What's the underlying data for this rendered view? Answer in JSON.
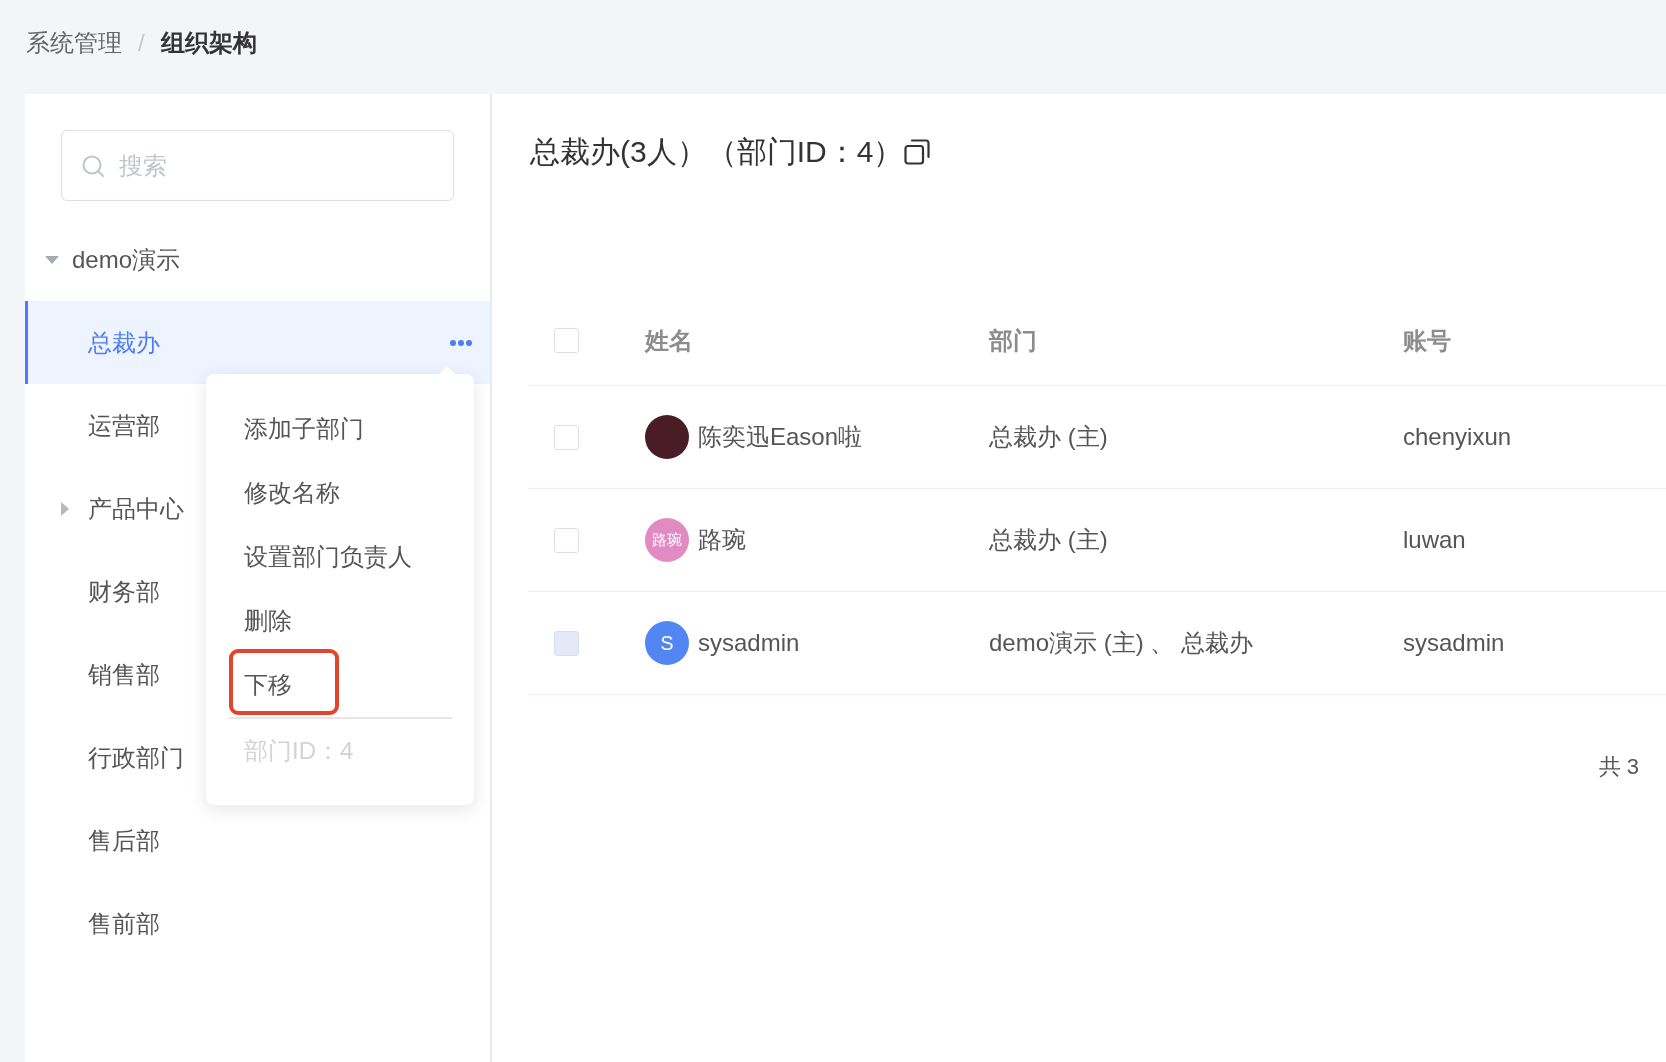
{
  "breadcrumb": {
    "items": [
      {
        "label": "系统管理",
        "current": false
      },
      {
        "label": "组织架构",
        "current": true
      }
    ],
    "separator": "/"
  },
  "sidebar": {
    "search": {
      "placeholder": "搜索"
    },
    "tree": [
      {
        "label": "demo演示",
        "kind": "folder",
        "expanded": true,
        "selected": false,
        "children": [
          {
            "label": "总裁办",
            "kind": "leaf",
            "selected": true
          },
          {
            "label": "运营部",
            "kind": "leaf",
            "selected": false
          },
          {
            "label": "产品中心",
            "kind": "folder",
            "expanded": false,
            "selected": false
          },
          {
            "label": "财务部",
            "kind": "leaf",
            "selected": false
          },
          {
            "label": "销售部",
            "kind": "leaf",
            "selected": false
          },
          {
            "label": "行政部门",
            "kind": "leaf",
            "selected": false
          },
          {
            "label": "售后部",
            "kind": "leaf",
            "selected": false
          },
          {
            "label": "售前部",
            "kind": "leaf",
            "selected": false
          }
        ]
      }
    ],
    "context_menu": {
      "items": [
        {
          "label": "添加子部门",
          "highlighted": false
        },
        {
          "label": "修改名称",
          "highlighted": false
        },
        {
          "label": "设置部门负责人",
          "highlighted": false
        },
        {
          "label": "删除",
          "highlighted": false
        },
        {
          "label": "下移",
          "highlighted": true
        }
      ],
      "footer": "部门ID：4"
    }
  },
  "department": {
    "title": "总裁办(3人）（部门ID：4）"
  },
  "table": {
    "select_all": {
      "checked": false
    },
    "columns": [
      "姓名",
      "部门",
      "账号"
    ],
    "rows": [
      {
        "checked": false,
        "disabled": false,
        "avatar": {
          "kind": "photo"
        },
        "name": "陈奕迅Eason啦",
        "department": "总裁办 (主)",
        "account": "chenyixun"
      },
      {
        "checked": false,
        "disabled": false,
        "avatar": {
          "kind": "text",
          "text": "路琬",
          "color": "#e18bc3"
        },
        "name": "路琬",
        "department": "总裁办 (主)",
        "account": "luwan"
      },
      {
        "checked": false,
        "disabled": true,
        "avatar": {
          "kind": "text",
          "text": "S",
          "color": "#5286f3"
        },
        "name": "sysadmin",
        "department": "demo演示 (主) 、 总裁办",
        "account": "sysadmin"
      }
    ]
  },
  "total": "共 3"
}
